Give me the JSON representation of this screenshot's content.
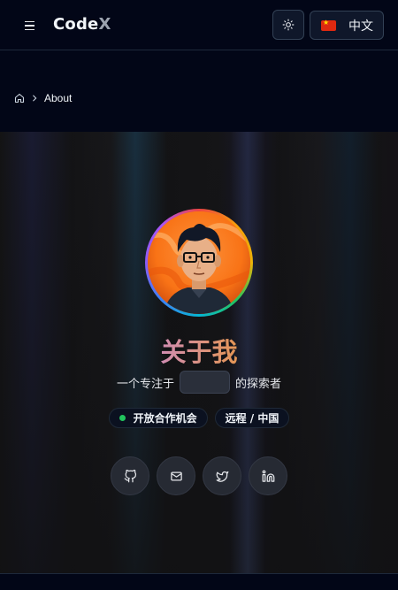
{
  "header": {
    "logo_text": "Code",
    "logo_accent": "X",
    "language": {
      "label": "中文",
      "flag": "china-flag-icon"
    },
    "theme_icon": "sun-icon",
    "menu_icon": "hamburger-menu-icon"
  },
  "breadcrumb": {
    "home_icon": "home-icon",
    "separator_icon": "chevron-right-icon",
    "current": "About"
  },
  "hero": {
    "title": "关于我",
    "subtitle_prefix": "一个专注于",
    "subtitle_suffix": "的探索者",
    "badges": [
      {
        "label": "开放合作机会",
        "status_color": "#22c55e"
      },
      {
        "label": "远程 / 中国"
      }
    ],
    "socials": [
      {
        "icon": "github-icon"
      },
      {
        "icon": "mail-icon"
      },
      {
        "icon": "twitter-icon"
      },
      {
        "icon": "linkedin-icon"
      }
    ]
  },
  "colors": {
    "background": "#020617",
    "title_gradient_start": "#c084fc",
    "title_gradient_end": "#f59e0b",
    "status_green": "#22c55e"
  }
}
